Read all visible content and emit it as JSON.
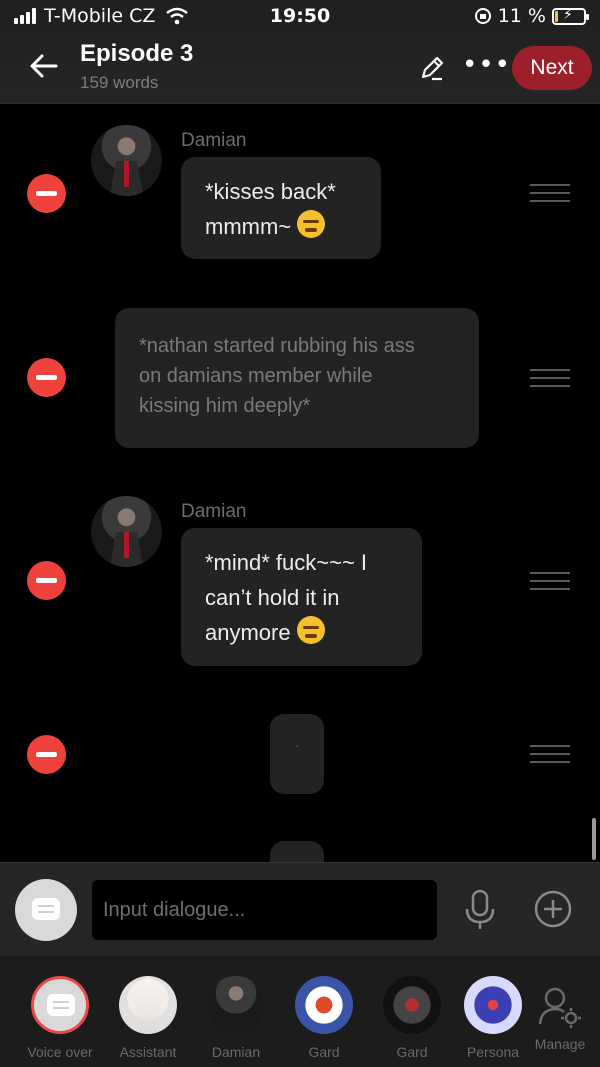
{
  "status": {
    "carrier": "T-Mobile CZ",
    "time": "19:50",
    "battery": "11 %",
    "battery_level": 0.11
  },
  "header": {
    "title": "Episode 3",
    "word_count": "159 words",
    "next_label": "Next"
  },
  "messages": [
    {
      "speaker": "Damian",
      "lines": [
        "*kisses back*",
        "mmmm~"
      ],
      "emoji": "smirking-face"
    },
    {
      "type": "narration",
      "lines": [
        "*nathan started rubbing his ass",
        "on damians member while",
        "kissing him deeply*"
      ]
    },
    {
      "speaker": "Damian",
      "lines": [
        "*mind* fuck~~~ I",
        "can’t hold it in",
        "anymore"
      ],
      "emoji": "weary-face"
    },
    {
      "type": "narration",
      "lines": [
        "."
      ]
    }
  ],
  "composer": {
    "placeholder": "Input dialogue..."
  },
  "characters": [
    {
      "label": "Voice over"
    },
    {
      "label": "Assistant"
    },
    {
      "label": "Damian"
    },
    {
      "label": "Gard"
    },
    {
      "label": "Gard"
    },
    {
      "label": "Persona"
    },
    {
      "label": "Manage"
    }
  ],
  "colors": {
    "accent_red": "#9c1f2c",
    "delete_red": "#f0423c",
    "bubble": "#232323"
  }
}
